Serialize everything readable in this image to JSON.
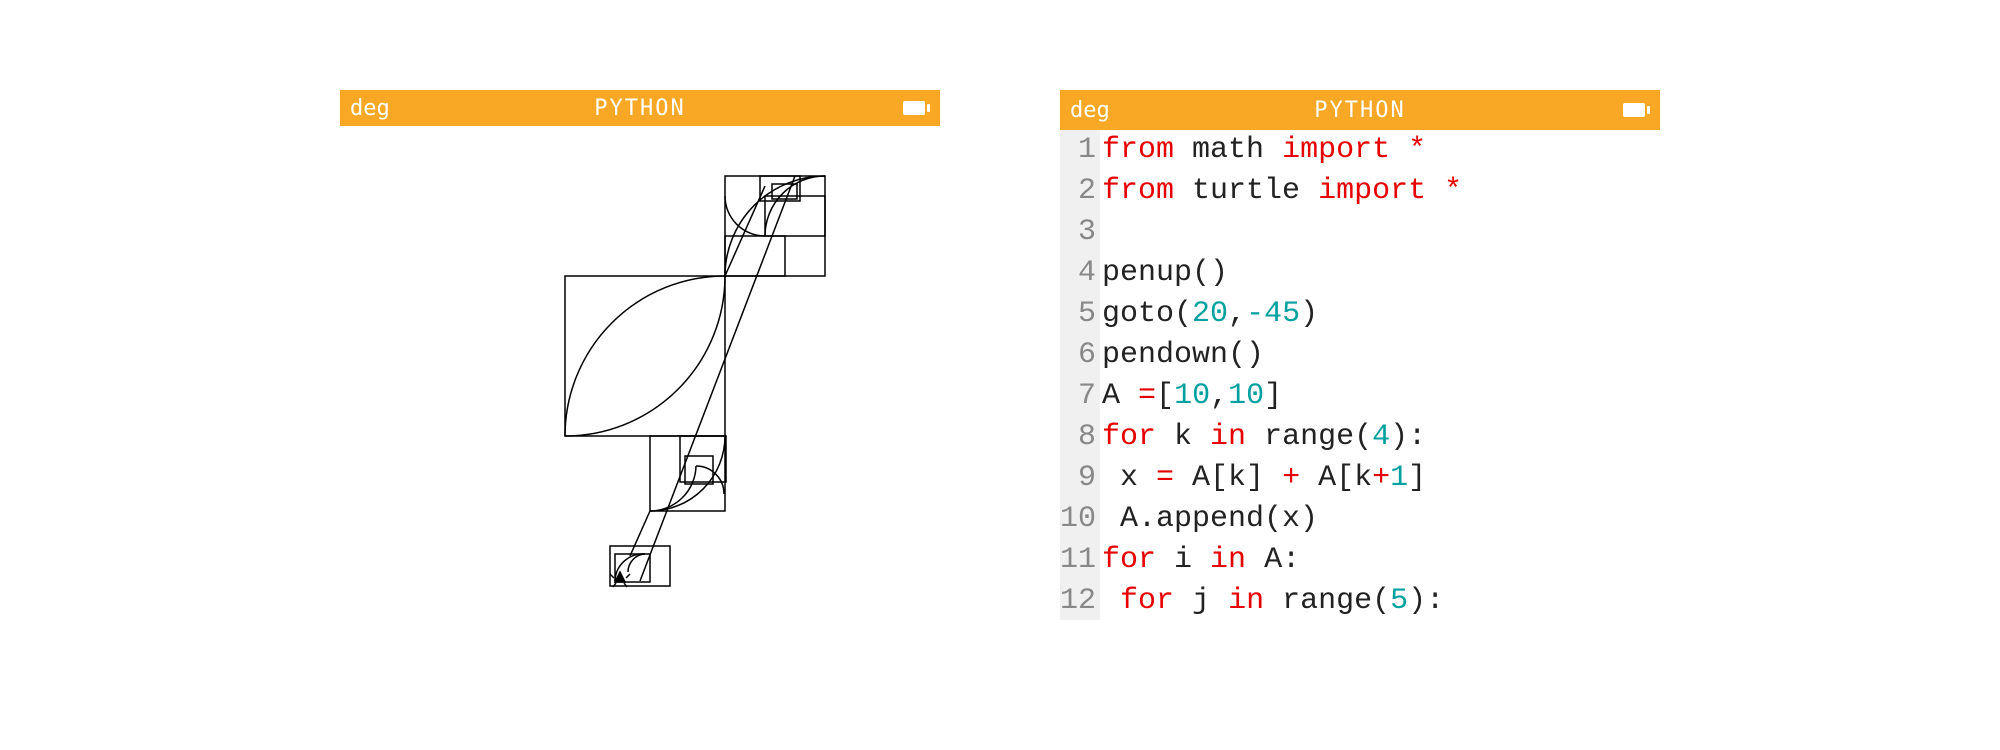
{
  "left_screen": {
    "titlebar": {
      "left": "deg",
      "center": "PYTHON"
    }
  },
  "right_screen": {
    "titlebar": {
      "left": "deg",
      "center": "PYTHON"
    },
    "gutter": [
      "1",
      "2",
      "3",
      "4",
      "5",
      "6",
      "7",
      "8",
      "9",
      "10",
      "11",
      "12"
    ],
    "code_lines": [
      [
        {
          "t": "from",
          "c": "kw"
        },
        {
          "t": " math ",
          "c": "plain"
        },
        {
          "t": "import",
          "c": "kw"
        },
        {
          "t": " *",
          "c": "op"
        }
      ],
      [
        {
          "t": "from",
          "c": "kw"
        },
        {
          "t": " turtle ",
          "c": "plain"
        },
        {
          "t": "import",
          "c": "kw"
        },
        {
          "t": " *",
          "c": "op"
        }
      ],
      [],
      [
        {
          "t": "penup()",
          "c": "plain"
        }
      ],
      [
        {
          "t": "goto(",
          "c": "plain"
        },
        {
          "t": "20",
          "c": "num"
        },
        {
          "t": ",",
          "c": "plain"
        },
        {
          "t": "-45",
          "c": "num"
        },
        {
          "t": ")",
          "c": "plain"
        }
      ],
      [
        {
          "t": "pendown()",
          "c": "plain"
        }
      ],
      [
        {
          "t": "A ",
          "c": "plain"
        },
        {
          "t": "=",
          "c": "op"
        },
        {
          "t": "[",
          "c": "plain"
        },
        {
          "t": "10",
          "c": "num"
        },
        {
          "t": ",",
          "c": "plain"
        },
        {
          "t": "10",
          "c": "num"
        },
        {
          "t": "]",
          "c": "plain"
        }
      ],
      [
        {
          "t": "for",
          "c": "kw"
        },
        {
          "t": " k ",
          "c": "plain"
        },
        {
          "t": "in",
          "c": "kw"
        },
        {
          "t": " range(",
          "c": "plain"
        },
        {
          "t": "4",
          "c": "num"
        },
        {
          "t": "):",
          "c": "plain"
        }
      ],
      [
        {
          "t": " x ",
          "c": "plain"
        },
        {
          "t": "=",
          "c": "op"
        },
        {
          "t": " A[k] ",
          "c": "plain"
        },
        {
          "t": "+",
          "c": "op"
        },
        {
          "t": " A[k",
          "c": "plain"
        },
        {
          "t": "+",
          "c": "op"
        },
        {
          "t": "1",
          "c": "num"
        },
        {
          "t": "]",
          "c": "plain"
        }
      ],
      [
        {
          "t": " A.append(x)",
          "c": "plain"
        }
      ],
      [
        {
          "t": "for",
          "c": "kw"
        },
        {
          "t": " i ",
          "c": "plain"
        },
        {
          "t": "in",
          "c": "kw"
        },
        {
          "t": " A:",
          "c": "plain"
        }
      ],
      [
        {
          "t": " ",
          "c": "plain"
        },
        {
          "t": "for",
          "c": "kw"
        },
        {
          "t": " j ",
          "c": "plain"
        },
        {
          "t": "in",
          "c": "kw"
        },
        {
          "t": " range(",
          "c": "plain"
        },
        {
          "t": "5",
          "c": "num"
        },
        {
          "t": "):",
          "c": "plain"
        }
      ]
    ]
  }
}
